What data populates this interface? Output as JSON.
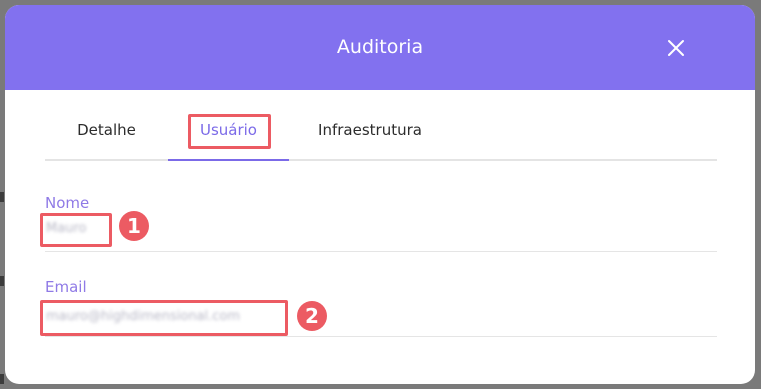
{
  "modal": {
    "title": "Auditoria",
    "close_icon": "close-icon"
  },
  "tabs": [
    {
      "label": "Detalhe",
      "active": false
    },
    {
      "label": "Usuário",
      "active": true
    },
    {
      "label": "Infraestrutura",
      "active": false
    }
  ],
  "fields": [
    {
      "label": "Nome",
      "value": "Mauro",
      "marker": "1"
    },
    {
      "label": "Email",
      "value": "mauro@highdimensional.com",
      "marker": "2"
    }
  ],
  "colors": {
    "header_bg": "#8271ef",
    "accent": "#7b6ae8",
    "highlight": "#ec5b63"
  }
}
